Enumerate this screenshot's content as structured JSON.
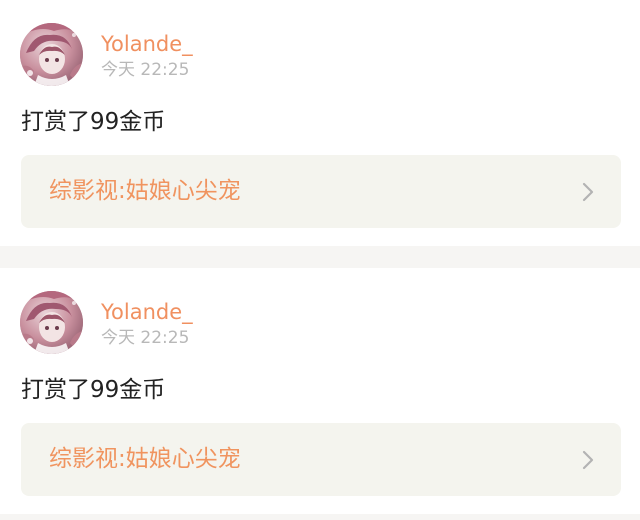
{
  "feed": {
    "items": [
      {
        "username": "Yolande_",
        "timestamp": "今天 22:25",
        "message": "打赏了99金币",
        "book_title": "综影视:姑娘心尖宠",
        "avatar_icon": "user-avatar-anime-girl",
        "chevron_icon": "chevron-right-icon"
      },
      {
        "username": "Yolande_",
        "timestamp": "今天 22:25",
        "message": "打赏了99金币",
        "book_title": "综影视:姑娘心尖宠",
        "avatar_icon": "user-avatar-anime-girl",
        "chevron_icon": "chevron-right-icon"
      }
    ]
  },
  "colors": {
    "accent_orange": "#f09060",
    "timestamp_gray": "#b8b8b8",
    "message_text": "#222222",
    "link_card_bg": "#f4f4ee",
    "divider_bg": "#f6f5f3"
  }
}
